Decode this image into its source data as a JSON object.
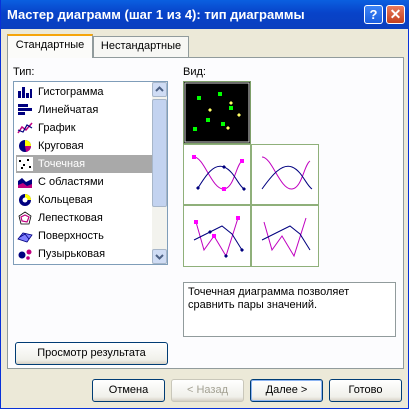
{
  "window": {
    "title": "Мастер диаграмм (шаг 1 из 4): тип диаграммы"
  },
  "titlebar_buttons": {
    "help": "?",
    "close": "✕"
  },
  "tabs": [
    {
      "label": "Стандартные",
      "active": true
    },
    {
      "label": "Нестандартные",
      "active": false
    }
  ],
  "type_label": "Тип:",
  "view_label": "Вид:",
  "chart_types": [
    {
      "label": "Гистограмма",
      "icon": "column-chart-icon"
    },
    {
      "label": "Линейчатая",
      "icon": "bar-chart-icon"
    },
    {
      "label": "График",
      "icon": "line-chart-icon"
    },
    {
      "label": "Круговая",
      "icon": "pie-chart-icon"
    },
    {
      "label": "Точечная",
      "icon": "scatter-chart-icon",
      "selected": true
    },
    {
      "label": "С областями",
      "icon": "area-chart-icon"
    },
    {
      "label": "Кольцевая",
      "icon": "doughnut-chart-icon"
    },
    {
      "label": "Лепестковая",
      "icon": "radar-chart-icon"
    },
    {
      "label": "Поверхность",
      "icon": "surface-chart-icon"
    },
    {
      "label": "Пузырьковая",
      "icon": "bubble-chart-icon"
    }
  ],
  "subtypes": [
    {
      "icon": "scatter-markers-icon",
      "selected": true
    },
    {
      "icon": "scatter-smooth-markers-icon"
    },
    {
      "icon": "scatter-smooth-lines-icon"
    },
    {
      "icon": "scatter-straight-markers-icon"
    },
    {
      "icon": "scatter-straight-lines-icon"
    }
  ],
  "description": "Точечная диаграмма позволяет сравнить пары значений.",
  "buttons": {
    "preview": "Просмотр результата",
    "cancel": "Отмена",
    "back": "< Назад",
    "next": "Далее >",
    "finish": "Готово"
  },
  "colors": {
    "title_bar": "#0a5fe0",
    "selection": "#a9a9a9",
    "dialog": "#ece9d8"
  }
}
